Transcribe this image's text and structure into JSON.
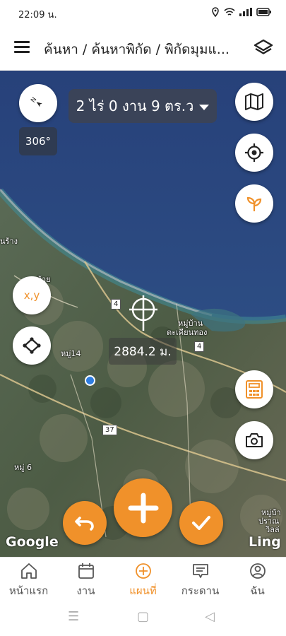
{
  "status_bar": {
    "time": "22:09 น.",
    "icons": [
      "location-icon",
      "wifi-icon",
      "signal-icon",
      "battery-icon"
    ]
  },
  "header": {
    "breadcrumb": "ค้นหา / ค้นหาพิกัด / พิกัดมุมแ..."
  },
  "map": {
    "compass_heading": "306°",
    "area_text": "2 ไร่ 0 งาน 9 ตร.ว",
    "distance_text": "2884.2 ม.",
    "xy_label": "x,y",
    "place_labels": [
      "นร้าง",
      "บ้าย",
      "หมู่บ้าน",
      "ตะเคียนทอง",
      "หมู่14",
      "หมู่ 6",
      "หมู่บ้า",
      "ปราณ",
      "วิลล่"
    ],
    "road_numbers": [
      "4",
      "4",
      "37"
    ],
    "attribution_left": "Google",
    "attribution_right": "Ling"
  },
  "bottom_nav": {
    "items": [
      {
        "label": "หน้าแรก",
        "icon": "home-icon"
      },
      {
        "label": "งาน",
        "icon": "calendar-icon"
      },
      {
        "label": "แผนที่",
        "icon": "map-plus-icon",
        "active": true
      },
      {
        "label": "กระดาน",
        "icon": "board-icon"
      },
      {
        "label": "ฉัน",
        "icon": "user-icon"
      }
    ]
  },
  "colors": {
    "accent": "#f0912a",
    "dark_pill": "#3a4358",
    "user_dot": "#2f7de1"
  }
}
